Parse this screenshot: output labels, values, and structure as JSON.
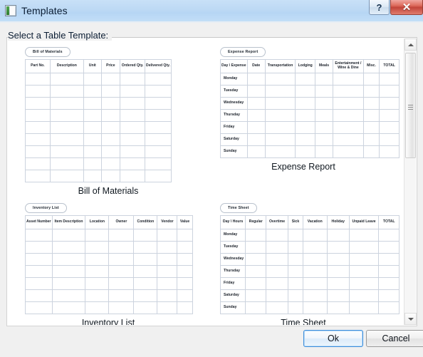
{
  "window": {
    "title": "Templates",
    "icon": "table-template-icon",
    "caption_buttons": [
      {
        "name": "help-button",
        "glyph": "?"
      },
      {
        "name": "close-button",
        "glyph": "✕"
      }
    ]
  },
  "group": {
    "label": "Select a Table Template:"
  },
  "scrollbar": {
    "up_arrow": "scroll-up-arrow",
    "down_arrow": "scroll-down-arrow",
    "thumb": "scroll-thumb"
  },
  "footer": {
    "ok_label": "Ok",
    "cancel_label": "Cancel"
  },
  "templates": [
    {
      "pill": "Bill of Materials",
      "caption": "Bill of Materials",
      "columns": [
        "Part No.",
        "Description",
        "Unit",
        "Price",
        "Ordered Qty.",
        "Delivered Qty."
      ],
      "col_widths": [
        "17%",
        "23%",
        "12%",
        "13%",
        "17%",
        "18%"
      ],
      "row_labels": [],
      "empty_rows": 9
    },
    {
      "pill": "Expense Report",
      "caption": "Expense Report",
      "columns": [
        "Day \\ Expense",
        "Date",
        "Transportation",
        "Lodging",
        "Meals",
        "Entertainment / Wine & Dine",
        "Misc.",
        "TOTAL"
      ],
      "col_widths": [
        "15%",
        "10%",
        "17%",
        "11%",
        "10%",
        "17%",
        "9%",
        "11%"
      ],
      "row_labels": [
        "Monday",
        "Tuesday",
        "Wednesday",
        "Thursday",
        "Friday",
        "Saturday",
        "Sunday"
      ],
      "empty_rows": 0
    },
    {
      "pill": "Inventory List",
      "caption": "Inventory List",
      "columns": [
        "Asset Number",
        "Item Description",
        "Location",
        "Owner",
        "Condition",
        "Vendor",
        "Value"
      ],
      "col_widths": [
        "16%",
        "20%",
        "14%",
        "15%",
        "14%",
        "12%",
        "9%"
      ],
      "row_labels": [],
      "empty_rows": 7
    },
    {
      "pill": "Time Sheet",
      "caption": "Time Sheet",
      "columns": [
        "Day \\ Hours",
        "Regular",
        "Overtime",
        "Sick",
        "Vacation",
        "Holiday",
        "Unpaid Leave",
        "TOTAL"
      ],
      "col_widths": [
        "13%",
        "11%",
        "12%",
        "8%",
        "13%",
        "12%",
        "16%",
        "11%"
      ],
      "row_labels": [
        "Monday",
        "Tuesday",
        "Wednesday",
        "Thursday",
        "Friday",
        "Saturday",
        "Sunday"
      ],
      "empty_rows": 0
    }
  ],
  "colors": {
    "titlebar": "#bdd9f4",
    "close_button": "#c2453a",
    "focus_border": "#3c8ddb",
    "table_grid": "#ccd3de",
    "table_outer": "#9aa4b2"
  }
}
